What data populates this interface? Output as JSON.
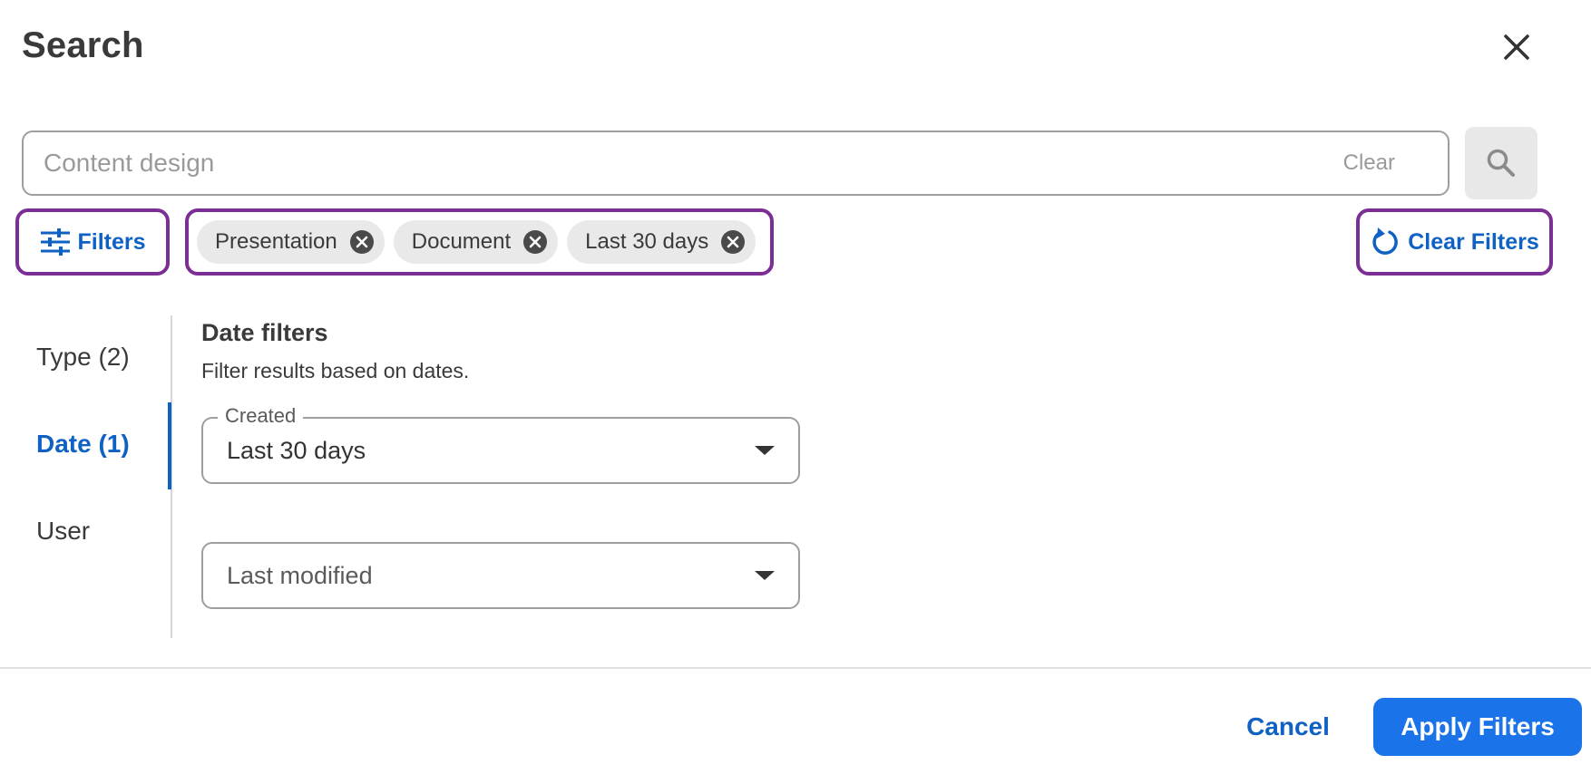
{
  "header": {
    "title": "Search",
    "close_icon": "close-icon"
  },
  "search": {
    "placeholder": "Content design",
    "value": "",
    "clear_label": "Clear",
    "search_icon": "search-icon"
  },
  "toolbar": {
    "filters_label": "Filters",
    "filters_icon": "sliders-icon",
    "clear_filters_label": "Clear Filters",
    "clear_filters_icon": "refresh-icon"
  },
  "active_filters": [
    {
      "label": "Presentation"
    },
    {
      "label": "Document"
    },
    {
      "label": "Last 30 days"
    }
  ],
  "sidebar": {
    "items": [
      {
        "label": "Type (2)",
        "active": false
      },
      {
        "label": "Date (1)",
        "active": true
      },
      {
        "label": "User",
        "active": false
      }
    ]
  },
  "date_filters": {
    "title": "Date filters",
    "description": "Filter results based on dates.",
    "created": {
      "label": "Created",
      "value": "Last 30 days"
    },
    "last_modified": {
      "placeholder": "Last modified",
      "value": ""
    }
  },
  "footer": {
    "cancel_label": "Cancel",
    "apply_label": "Apply Filters"
  },
  "colors": {
    "accent": "#0f62c4",
    "primary_button": "#1a73e8",
    "highlight": "#7b2e94"
  }
}
